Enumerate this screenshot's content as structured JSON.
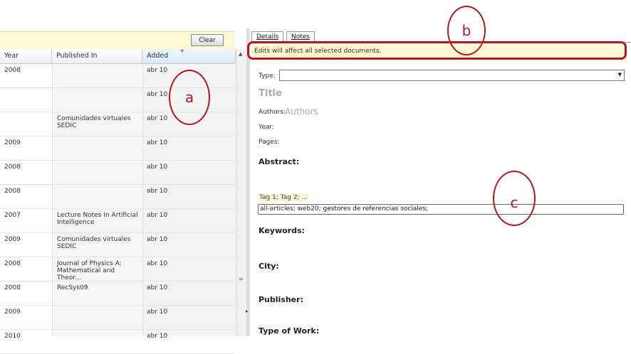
{
  "left_pane": {
    "clear_label": "Clear",
    "columns": [
      "Year",
      "Published In",
      "Added"
    ],
    "rows": [
      {
        "year": "2008",
        "published_in": "",
        "added": "abr 10"
      },
      {
        "year": "",
        "published_in": "",
        "added": "abr 10"
      },
      {
        "year": "",
        "published_in": "Comunidades virtuales SEDIC",
        "added": "abr 10"
      },
      {
        "year": "2009",
        "published_in": "",
        "added": "abr 10"
      },
      {
        "year": "2008",
        "published_in": "",
        "added": "abr 10"
      },
      {
        "year": "2008",
        "published_in": "",
        "added": "abr 10"
      },
      {
        "year": "2007",
        "published_in": "Lecture Notes In Artificial Intelligence",
        "added": "abr 10"
      },
      {
        "year": "2009",
        "published_in": "Comunidades virtuales SEDIC",
        "added": "abr 10"
      },
      {
        "year": "2008",
        "published_in": "Journal of Physics A: Mathematical and Theor...",
        "added": "abr 10"
      },
      {
        "year": "2008",
        "published_in": "RecSys09",
        "added": "abr 10"
      },
      {
        "year": "2009",
        "published_in": "",
        "added": "abr 10"
      },
      {
        "year": "2010",
        "published_in": "",
        "added": "abr 10"
      }
    ]
  },
  "right_pane": {
    "tabs": [
      "Details",
      "Notes"
    ],
    "warning": "Edits will affect all selected documents.",
    "type_label": "Type:",
    "title_placeholder": "Title",
    "authors_label": "Authors:",
    "authors_placeholder": "Authors",
    "year_label": "Year:",
    "pages_label": "Pages:",
    "abstract_label": "Abstract:",
    "tags_placeholder": "Tag 1; Tag 2; ...",
    "tags_value": "all-articles; web20; gestores de referencias sociales;",
    "keywords_label": "Keywords:",
    "city_label": "City:",
    "publisher_label": "Publisher:",
    "type_of_work_label": "Type of Work:"
  },
  "annotations": {
    "a": "a",
    "b": "b",
    "c": "c"
  },
  "colors": {
    "annotation_red": "#b3171f",
    "highlight_yellow": "#fdf9d3"
  }
}
